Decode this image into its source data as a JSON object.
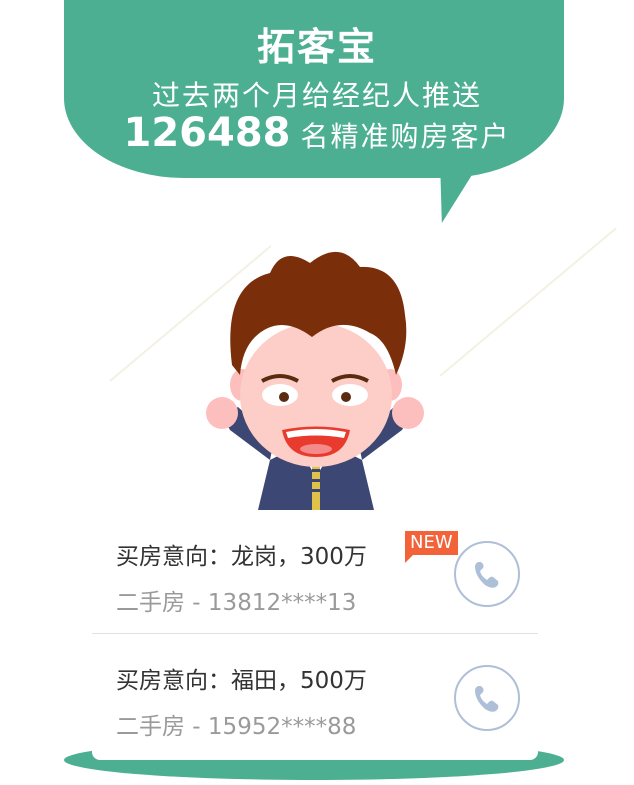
{
  "banner": {
    "title": "拓客宝",
    "line1": "过去两个月给经纪人推送",
    "count": "126488",
    "line2_suffix": "名精准购房客户"
  },
  "colors": {
    "accent_green": "#4caf91",
    "badge_red": "#f2633a",
    "phone_blue": "#aebfd8"
  },
  "listings": [
    {
      "intent": "买房意向：龙岗，300万",
      "badge": "NEW",
      "detail": "二手房 - 13812****13",
      "icon": "phone-icon"
    },
    {
      "intent": "买房意向：福田，500万",
      "detail": "二手房 - 15952****88",
      "icon": "phone-icon"
    }
  ]
}
